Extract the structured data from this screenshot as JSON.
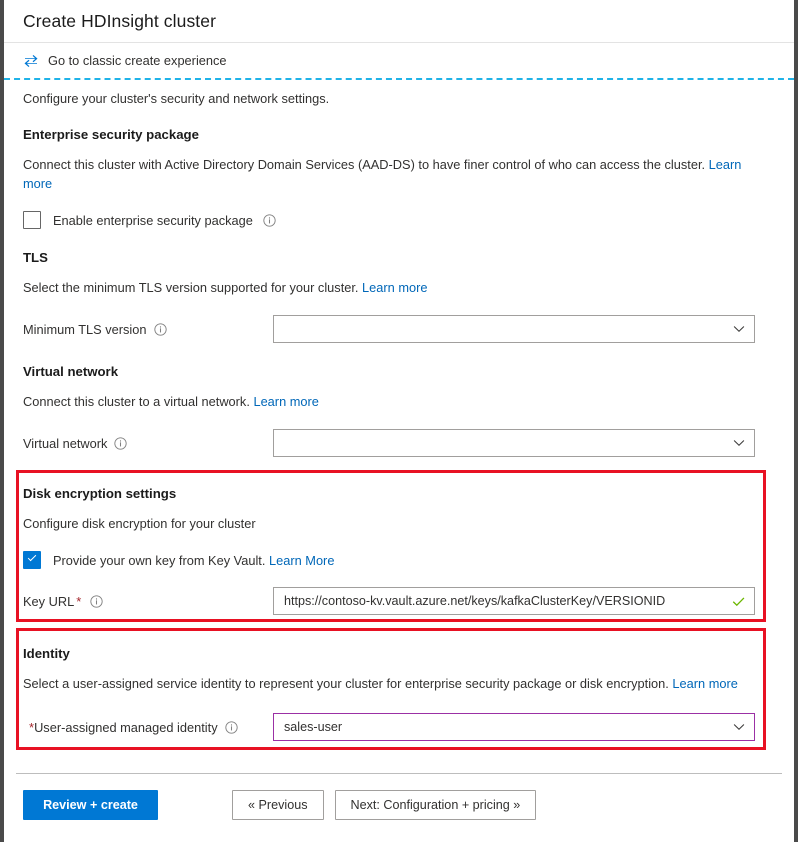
{
  "window": {
    "title": "Create HDInsight cluster"
  },
  "classic_link": {
    "icon": "swap-arrows-icon",
    "label": "Go to classic create experience"
  },
  "intro": "Configure your cluster's security and network settings.",
  "sections": {
    "esp": {
      "heading": "Enterprise security package",
      "description": "Connect this cluster with Active Directory Domain Services (AAD-DS) to have finer control of who can access the cluster.",
      "learn_more": "Learn more",
      "checkbox_label": "Enable enterprise security package",
      "checkbox_checked": false
    },
    "tls": {
      "heading": "TLS",
      "description": "Select the minimum TLS version supported for your cluster.",
      "learn_more": "Learn more",
      "field_label": "Minimum TLS version",
      "field_value": "",
      "field_placeholder": ""
    },
    "vnet": {
      "heading": "Virtual network",
      "description": "Connect this cluster to a virtual network.",
      "learn_more": "Learn more",
      "field_label": "Virtual network",
      "field_value": "",
      "field_placeholder": ""
    },
    "disk_encryption": {
      "heading": "Disk encryption settings",
      "description": "Configure disk encryption for your cluster",
      "checkbox_label": "Provide your own key from Key Vault.",
      "checkbox_checked": true,
      "learn_more": "Learn More",
      "field_label": "Key URL",
      "field_required_mark": "*",
      "field_value": "https://contoso-kv.vault.azure.net/keys/kafkaClusterKey/VERSIONID",
      "field_valid": true,
      "highlighted": true
    },
    "identity": {
      "heading": "Identity",
      "description": "Select a user-assigned service identity to represent your cluster for enterprise security package or disk encryption.",
      "learn_more": "Learn more",
      "field_required_mark": "*",
      "field_label": "User-assigned managed identity",
      "field_value": "sales-user",
      "highlighted": true
    }
  },
  "footer": {
    "review_create": "Review + create",
    "previous": "« Previous",
    "next": "Next: Configuration + pricing »"
  },
  "colors": {
    "accent_blue": "#0078d4",
    "link_blue": "#0067b8",
    "highlight_red": "#e81123",
    "required_red": "#a4262c",
    "dashed_separator": "#20b3e8",
    "valid_green": "#6bb700",
    "identity_dropdown_border": "#9b30a5"
  }
}
